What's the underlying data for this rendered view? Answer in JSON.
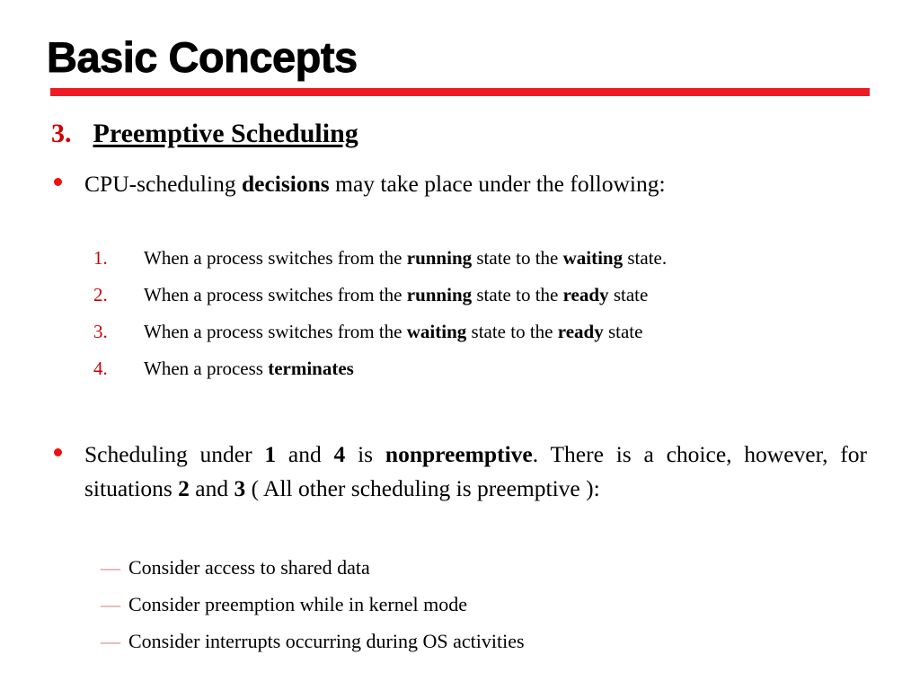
{
  "slide": {
    "title": "Basic Concepts",
    "colors": {
      "title_rule": "#ED1C24",
      "section_number": "#CC0000",
      "bullet_dot": "#EE1111",
      "list_number": "#CC0000",
      "dash_marker": "#DD8888",
      "text": "#000000",
      "background": "#FFFFFF"
    }
  },
  "section": {
    "number": "3.",
    "heading": "Preemptive Scheduling"
  },
  "bullets": [
    {
      "marker": "bullet-dot",
      "parts": [
        {
          "text": "CPU-scheduling ",
          "bold": false
        },
        {
          "text": "decisions",
          "bold": true
        },
        {
          "text": " may take place under the following:",
          "bold": false
        }
      ]
    },
    {
      "marker": "bullet-dot",
      "parts": [
        {
          "text": "Scheduling under ",
          "bold": false
        },
        {
          "text": "1",
          "bold": true
        },
        {
          "text": " and ",
          "bold": false
        },
        {
          "text": "4",
          "bold": true
        },
        {
          "text": " is ",
          "bold": false
        },
        {
          "text": "nonpreemptive",
          "bold": true
        },
        {
          "text": ". There is a choice, however, for situations ",
          "bold": false
        },
        {
          "text": "2",
          "bold": true
        },
        {
          "text": " and ",
          "bold": false
        },
        {
          "text": "3",
          "bold": true
        },
        {
          "text": " ( All other scheduling is preemptive ):",
          "bold": false
        }
      ]
    }
  ],
  "numbered_list": [
    {
      "marker": "1.",
      "parts": [
        {
          "text": "When a process switches from the ",
          "bold": false
        },
        {
          "text": "running",
          "bold": true
        },
        {
          "text": " state to the ",
          "bold": false
        },
        {
          "text": "waiting",
          "bold": true
        },
        {
          "text": " state.",
          "bold": false
        }
      ]
    },
    {
      "marker": "2.",
      "parts": [
        {
          "text": "When a process switches from the ",
          "bold": false
        },
        {
          "text": "running",
          "bold": true
        },
        {
          "text": " state to the ",
          "bold": false
        },
        {
          "text": "ready",
          "bold": true
        },
        {
          "text": " state",
          "bold": false
        }
      ]
    },
    {
      "marker": "3.",
      "parts": [
        {
          "text": "When a process switches from the ",
          "bold": false
        },
        {
          "text": "waiting",
          "bold": true
        },
        {
          "text": " state to the ",
          "bold": false
        },
        {
          "text": "ready",
          "bold": true
        },
        {
          "text": " state",
          "bold": false
        }
      ]
    },
    {
      "marker": "4.",
      "parts": [
        {
          "text": "When a process ",
          "bold": false
        },
        {
          "text": "terminates",
          "bold": true
        }
      ]
    }
  ],
  "dash_list": [
    {
      "marker": "—",
      "label": "Consider access to shared data"
    },
    {
      "marker": "—",
      "label": "Consider preemption while in kernel mode"
    },
    {
      "marker": "—",
      "label": "Consider interrupts occurring during OS activities"
    }
  ]
}
